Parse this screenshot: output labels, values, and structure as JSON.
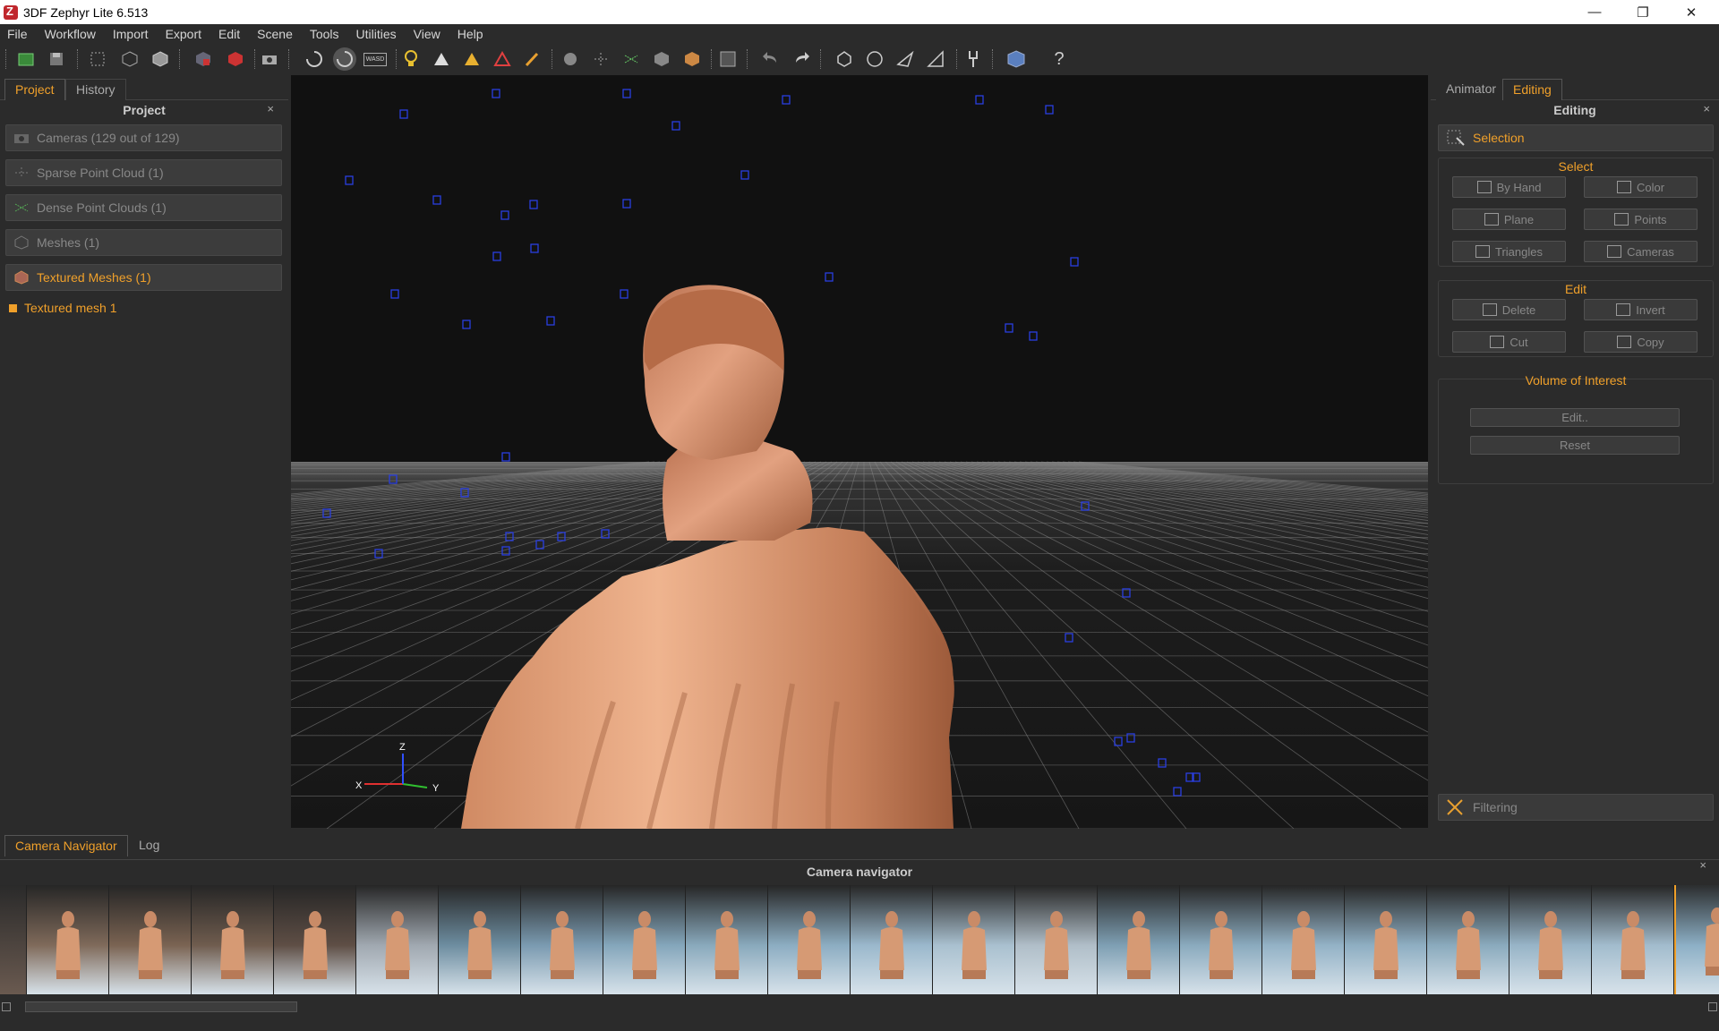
{
  "window": {
    "title": "3DF Zephyr Lite 6.513",
    "minimize_icon": "minimize-icon",
    "restore_icon": "restore-icon",
    "close_icon": "close-icon"
  },
  "menu": [
    "File",
    "Workflow",
    "Import",
    "Export",
    "Edit",
    "Scene",
    "Tools",
    "Utilities",
    "View",
    "Help"
  ],
  "toolbar": {
    "icons": [
      "new-project-icon",
      "open-icon",
      "save-icon",
      "select-icon",
      "grid-icon",
      "cube-icon",
      "cube-split-icon",
      "cube-red-icon",
      "camera-icon",
      "rotate-icon",
      "orbit-icon",
      "wasd-icon",
      "light-icon",
      "point-white-icon",
      "point-yellow-icon",
      "point-color-icon",
      "brush-icon",
      "filter-icon",
      "sparse-icon",
      "dense-icon",
      "mesh-icon",
      "textured-icon",
      "frame-icon",
      "undo-icon",
      "redo-icon",
      "lasso-icon",
      "circle-select-icon",
      "plane-select-icon",
      "ruler-icon",
      "tool-icon",
      "box-icon",
      "help-icon"
    ],
    "help_label": "?",
    "wasd_label": "WASD"
  },
  "left": {
    "tabs": [
      "Project",
      "History"
    ],
    "header": "Project",
    "close": "×",
    "rows": [
      {
        "label": "Cameras (129 out of 129)",
        "icon": "camera-icon"
      },
      {
        "label": "Sparse Point Cloud (1)",
        "icon": "sparse-cloud-icon"
      },
      {
        "label": "Dense Point Clouds (1)",
        "icon": "dense-cloud-icon"
      },
      {
        "label": "Meshes (1)",
        "icon": "mesh-icon"
      },
      {
        "label": "Textured Meshes (1)",
        "icon": "textured-mesh-icon"
      }
    ],
    "tree_item": "Textured mesh 1"
  },
  "viewport": {
    "axis_x": "X",
    "axis_y": "Y",
    "axis_z": "Z"
  },
  "right": {
    "tabs": [
      "Animator",
      "Editing"
    ],
    "header": "Editing",
    "close": "×",
    "selection_label": "Selection",
    "select_title": "Select",
    "select_buttons": [
      "By Hand",
      "Color",
      "Plane",
      "Points",
      "Triangles",
      "Cameras"
    ],
    "edit_title": "Edit",
    "edit_buttons": [
      "Delete",
      "Invert",
      "Cut",
      "Copy"
    ],
    "voi_title": "Volume of Interest",
    "voi_buttons": [
      "Edit..",
      "Reset"
    ],
    "filtering_label": "Filtering"
  },
  "bottom": {
    "tabs": [
      "Camera Navigator",
      "Log"
    ],
    "header": "Camera navigator",
    "close": "×",
    "thumbnail_count": 21,
    "selected_thumbnail": 20
  },
  "colors": {
    "accent": "#f0a02a",
    "panel": "#2b2b2b",
    "viewport_bg": "#111111",
    "camera_marker": "#2a3fe0",
    "statue": "#d9906a"
  }
}
